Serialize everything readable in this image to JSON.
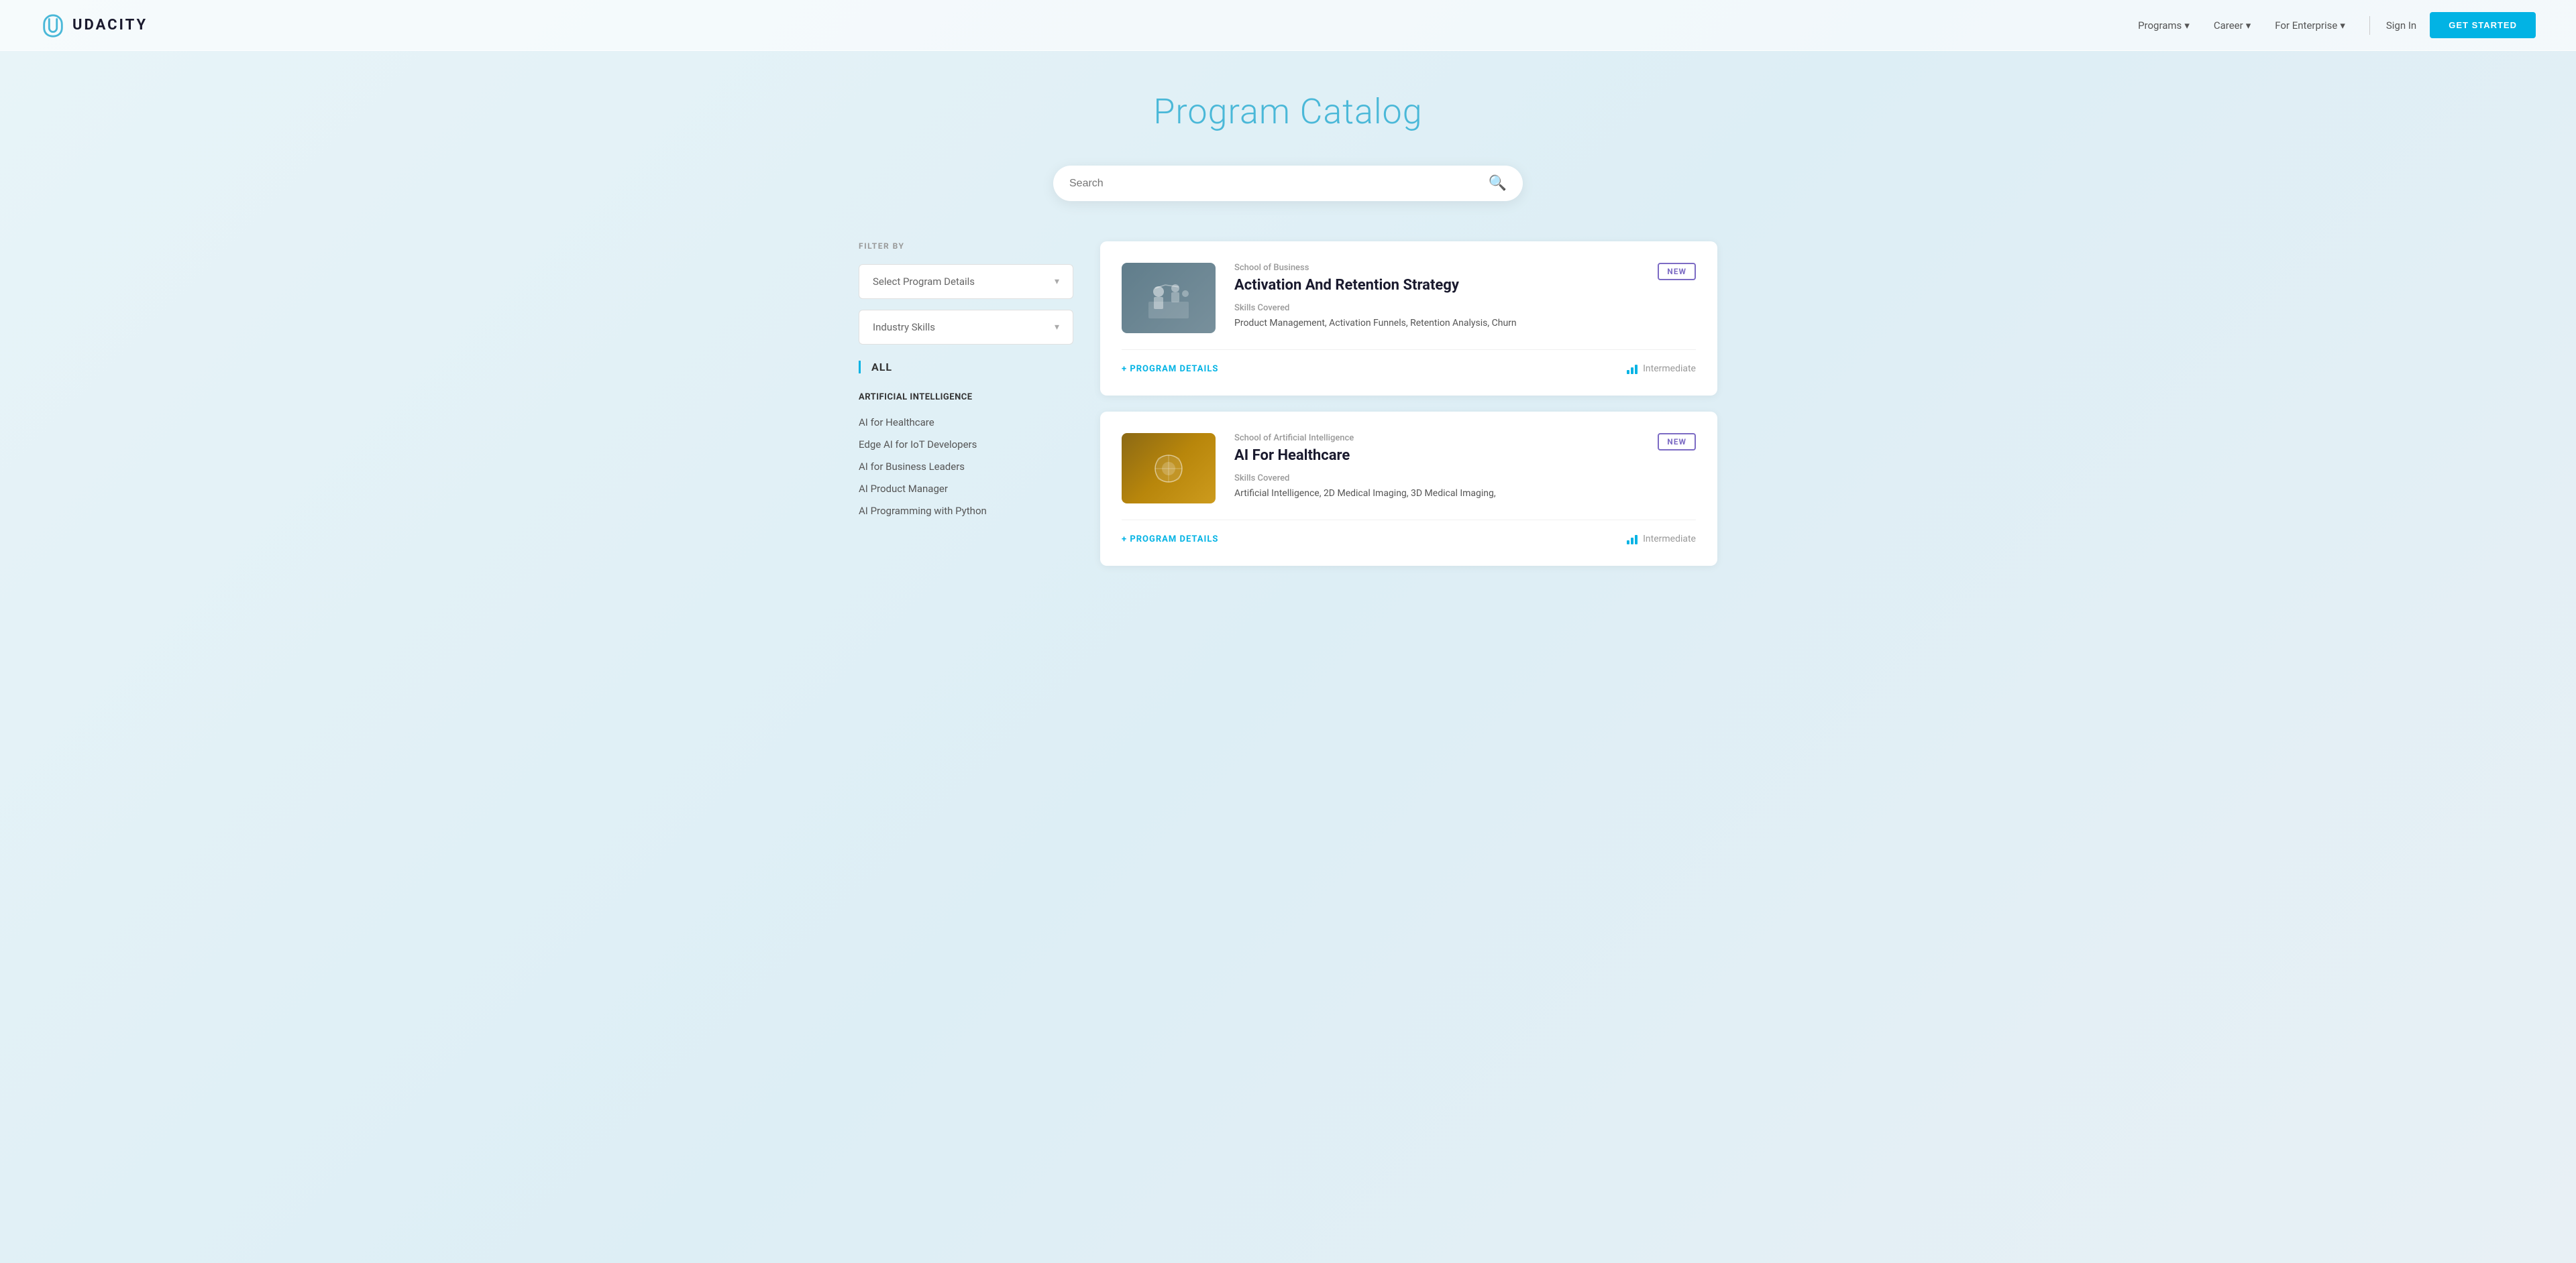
{
  "nav": {
    "logo_text": "UDACITY",
    "links": [
      {
        "label": "Programs",
        "has_dropdown": true
      },
      {
        "label": "Career",
        "has_dropdown": true
      },
      {
        "label": "For Enterprise",
        "has_dropdown": true
      }
    ],
    "sign_in": "Sign In",
    "get_started": "GET STARTED"
  },
  "hero": {
    "title": "Program Catalog"
  },
  "search": {
    "placeholder": "Search"
  },
  "sidebar": {
    "filter_label": "FILTER BY",
    "dropdown1": "Select Program Details",
    "dropdown2": "Industry Skills",
    "all_label": "ALL",
    "category_title": "ARTIFICIAL INTELLIGENCE",
    "items": [
      "AI for Healthcare",
      "Edge AI for IoT Developers",
      "AI for Business Leaders",
      "AI Product Manager",
      "AI Programming with Python"
    ]
  },
  "cards": [
    {
      "school": "School of Business",
      "title": "Activation And Retention Strategy",
      "badge": "NEW",
      "skills_label": "Skills Covered",
      "skills": "Product Management, Activation Funnels, Retention Analysis, Churn",
      "details_link": "+ PROGRAM DETAILS",
      "level": "Intermediate",
      "thumb_type": "business"
    },
    {
      "school": "School of Artificial Intelligence",
      "title": "AI For Healthcare",
      "badge": "NEW",
      "skills_label": "Skills Covered",
      "skills": "Artificial Intelligence, 2D Medical Imaging, 3D Medical Imaging,",
      "details_link": "+ PROGRAM DETAILS",
      "level": "Intermediate",
      "thumb_type": "ai"
    }
  ]
}
